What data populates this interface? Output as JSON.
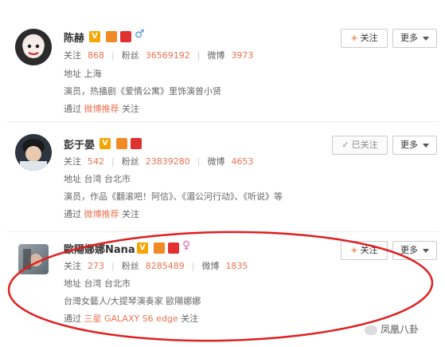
{
  "labels": {
    "follow": "关注",
    "fans": "粉丝",
    "weibo": "微博",
    "address": "地址",
    "via": "通过",
    "follow_btn": "关注",
    "followed_btn": "已关注",
    "more_btn": "更多",
    "plus": "+",
    "check": "✓"
  },
  "users": [
    {
      "name": "陈赫",
      "gender": "♂",
      "following": "868",
      "fans": "36569192",
      "weibo": "3973",
      "address": "上海",
      "bio": "演员，热播剧《爱情公寓》里饰演曾小贤",
      "via_link": "微博推荐",
      "via_suffix": "关注",
      "followed": false
    },
    {
      "name": "彭于晏",
      "following": "542",
      "fans": "23839280",
      "weibo": "4653",
      "address": "台湾 台北市",
      "bio": "演员，作品《翻滚吧！阿信》、《湄公河行动》、《听说》等",
      "via_link": "微博推荐",
      "via_suffix": "关注",
      "followed": true
    },
    {
      "name": "歐陽娜娜Nana",
      "gender": "♀",
      "following": "273",
      "fans": "8285489",
      "weibo": "1835",
      "address": "台湾 台北市",
      "bio": "台灣女藝人/大提琴演奏家 歐陽娜娜",
      "via_link": "三星 GALAXY S6 edge",
      "via_suffix": "关注",
      "followed": false
    }
  ],
  "watermark": "凤凰八卦",
  "colors": {
    "accent": "#eb7350",
    "ellipse": "#e02020",
    "male": "#4a90e2",
    "female": "#e86aa8"
  }
}
